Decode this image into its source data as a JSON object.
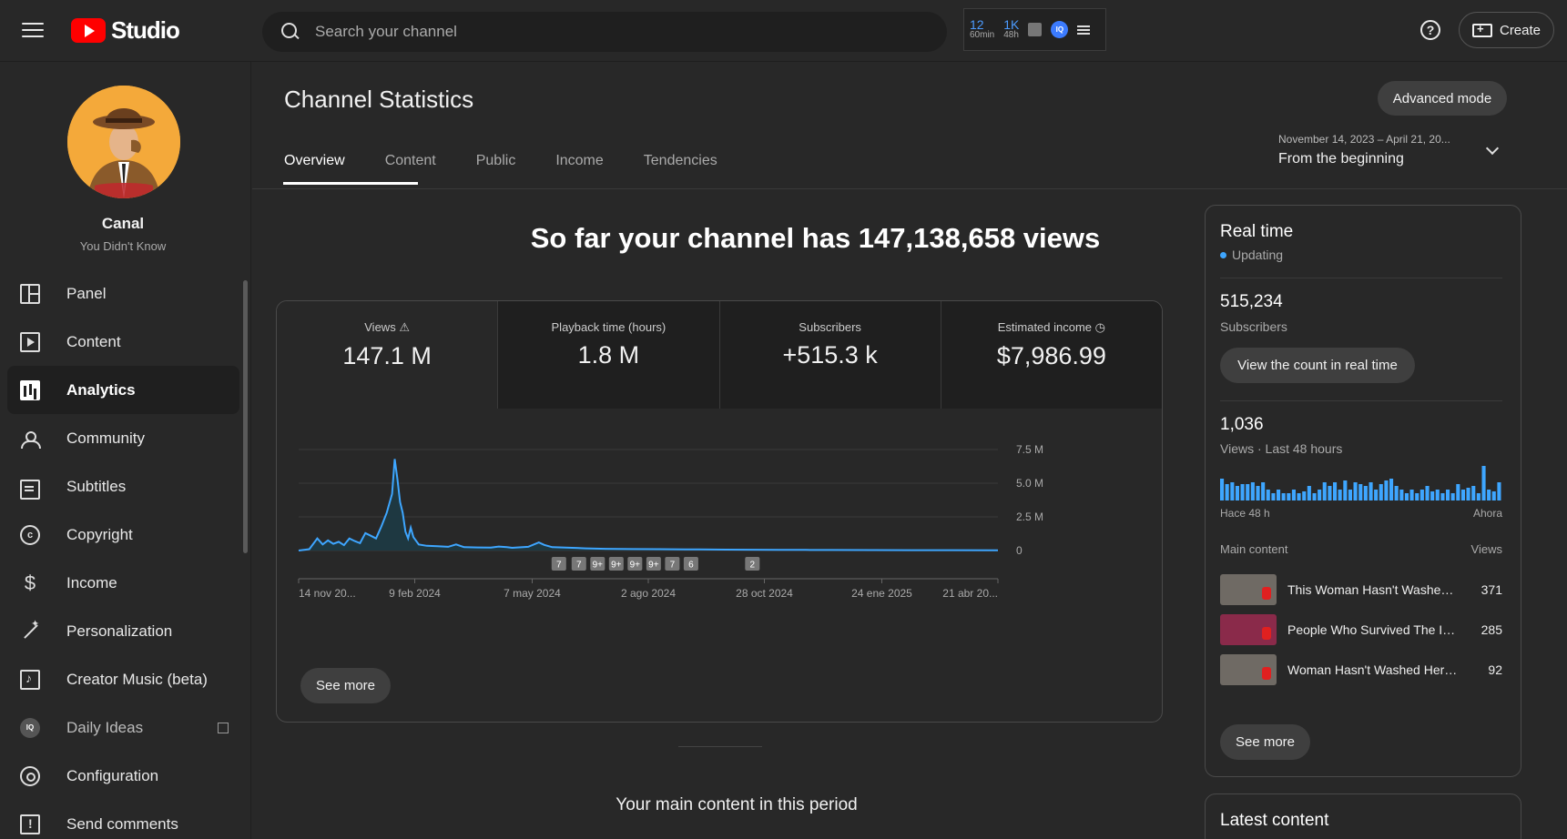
{
  "header": {
    "logo_text": "Studio",
    "search_placeholder": "Search your channel",
    "ext": {
      "stat1_value": "12",
      "stat1_label": "60min",
      "stat2_value": "1K",
      "stat2_label": "48h",
      "iq": "IQ"
    },
    "create_label": "Create",
    "help_glyph": "?"
  },
  "sidebar": {
    "channel_title": "Canal",
    "channel_subtitle": "You Didn't Know",
    "items": [
      {
        "label": "Panel",
        "icon": "dashboard-icon"
      },
      {
        "label": "Content",
        "icon": "content-icon"
      },
      {
        "label": "Analytics",
        "icon": "analytics-icon",
        "active": true
      },
      {
        "label": "Community",
        "icon": "community-icon"
      },
      {
        "label": "Subtitles",
        "icon": "subtitles-icon"
      },
      {
        "label": "Copyright",
        "icon": "copyright-icon"
      },
      {
        "label": "Income",
        "icon": "dollar-icon"
      },
      {
        "label": "Personalization",
        "icon": "magic-wand-icon"
      },
      {
        "label": "Creator Music (beta)",
        "icon": "music-icon"
      },
      {
        "label": "Daily Ideas",
        "icon": "iq-icon",
        "external": true
      },
      {
        "label": "Configuration",
        "icon": "gear-icon"
      },
      {
        "label": "Send comments",
        "icon": "feedback-icon"
      }
    ],
    "copyright_glyph": "c",
    "dollar_glyph": "$",
    "iq_glyph": "IQ"
  },
  "main": {
    "page_title": "Channel Statistics",
    "advanced_mode": "Advanced mode",
    "tabs": [
      "Overview",
      "Content",
      "Public",
      "Income",
      "Tendencies"
    ],
    "date_range": {
      "range": "November 14, 2023 – April 21, 20...",
      "label": "From the beginning"
    },
    "headline": "So far your channel has 147,138,658 views",
    "metrics": [
      {
        "label": "Views",
        "value": "147.1 M"
      },
      {
        "label": "Playback time (hours)",
        "value": "1.8 M"
      },
      {
        "label": "Subscribers",
        "value": "+515.3 k"
      },
      {
        "label": "Estimated income",
        "value": "$7,986.99"
      }
    ],
    "see_more": "See more",
    "main_content_title": "Your main content in this period"
  },
  "chart_data": {
    "type": "line",
    "ytick_labels": [
      "7.5 M",
      "5.0 M",
      "2.5 M",
      "0"
    ],
    "yticks": [
      7500000,
      5000000,
      2500000,
      0
    ],
    "ylim": [
      0,
      7500000
    ],
    "xtick_labels": [
      "14 nov 20...",
      "9 feb 2024",
      "7 may 2024",
      "2 ago 2024",
      "28 oct 2024",
      "24 ene 2025",
      "21 abr 20..."
    ],
    "x_range_days": [
      0,
      524
    ],
    "xtick_days": [
      0,
      87,
      175,
      262,
      349,
      437,
      524
    ],
    "series": [
      {
        "points": [
          [
            0,
            0
          ],
          [
            8,
            100000
          ],
          [
            14,
            900000
          ],
          [
            18,
            450000
          ],
          [
            22,
            750000
          ],
          [
            26,
            500000
          ],
          [
            30,
            650000
          ],
          [
            34,
            400000
          ],
          [
            38,
            900000
          ],
          [
            42,
            700000
          ],
          [
            46,
            550000
          ],
          [
            50,
            1300000
          ],
          [
            54,
            1100000
          ],
          [
            58,
            900000
          ],
          [
            62,
            1800000
          ],
          [
            66,
            2800000
          ],
          [
            70,
            4200000
          ],
          [
            72,
            6800000
          ],
          [
            74,
            5300000
          ],
          [
            76,
            3600000
          ],
          [
            78,
            2800000
          ],
          [
            80,
            1400000
          ],
          [
            82,
            900000
          ],
          [
            84,
            1700000
          ],
          [
            86,
            1000000
          ],
          [
            90,
            450000
          ],
          [
            96,
            350000
          ],
          [
            104,
            320000
          ],
          [
            112,
            280000
          ],
          [
            118,
            450000
          ],
          [
            124,
            250000
          ],
          [
            134,
            230000
          ],
          [
            144,
            220000
          ],
          [
            150,
            300000
          ],
          [
            156,
            250000
          ],
          [
            160,
            200000
          ],
          [
            172,
            280000
          ],
          [
            180,
            600000
          ],
          [
            184,
            420000
          ],
          [
            190,
            250000
          ],
          [
            200,
            220000
          ],
          [
            215,
            160000
          ],
          [
            230,
            130000
          ],
          [
            250,
            110000
          ],
          [
            270,
            100000
          ],
          [
            290,
            90000
          ],
          [
            300,
            80000
          ],
          [
            320,
            70000
          ],
          [
            340,
            60000
          ],
          [
            360,
            50000
          ],
          [
            380,
            45000
          ],
          [
            400,
            40000
          ],
          [
            430,
            35000
          ],
          [
            460,
            30000
          ],
          [
            490,
            25000
          ],
          [
            524,
            20000
          ]
        ]
      }
    ],
    "markers": [
      {
        "day": 195,
        "label": "7"
      },
      {
        "day": 210,
        "label": "7"
      },
      {
        "day": 224,
        "label": "9+"
      },
      {
        "day": 238,
        "label": "9+"
      },
      {
        "day": 252,
        "label": "9+"
      },
      {
        "day": 266,
        "label": "9+"
      },
      {
        "day": 280,
        "label": "7"
      },
      {
        "day": 294,
        "label": "6"
      },
      {
        "day": 340,
        "label": "2"
      }
    ],
    "colors": {
      "line": "#3ea6ff",
      "fill": "#1d3a44",
      "grid": "#3a3a3a"
    }
  },
  "realtime": {
    "title": "Real time",
    "status": "Updating",
    "subscribers_value": "515,234",
    "subscribers_label": "Subscribers",
    "count_button": "View the count in real time",
    "views_value": "1,036",
    "views_label": "Views · Last 48 hours",
    "bars": [
      0.6,
      0.45,
      0.5,
      0.4,
      0.45,
      0.45,
      0.5,
      0.4,
      0.5,
      0.3,
      0.2,
      0.3,
      0.2,
      0.2,
      0.3,
      0.2,
      0.25,
      0.4,
      0.2,
      0.3,
      0.5,
      0.4,
      0.5,
      0.3,
      0.55,
      0.3,
      0.5,
      0.45,
      0.4,
      0.5,
      0.3,
      0.45,
      0.55,
      0.6,
      0.4,
      0.3,
      0.2,
      0.3,
      0.2,
      0.3,
      0.4,
      0.25,
      0.3,
      0.2,
      0.3,
      0.2,
      0.45,
      0.3,
      0.35,
      0.4,
      0.2,
      0.95,
      0.3,
      0.25,
      0.5
    ],
    "bar_color": "#3ea6ff",
    "axis_left": "Hace 48 h",
    "axis_right": "Ahora",
    "list_header_left": "Main content",
    "list_header_right": "Views",
    "items": [
      {
        "title": "This Woman Hasn't Washed Her Hair...",
        "views": "371",
        "thumb_color": "#6f6a64"
      },
      {
        "title": "People Who Survived The Impossible",
        "views": "285",
        "thumb_color": "#8a2a4a"
      },
      {
        "title": "Woman Hasn't Washed Her Hair In...",
        "views": "92",
        "thumb_color": "#6f6a64"
      }
    ],
    "see_more": "See more"
  },
  "latest": {
    "title": "Latest content"
  }
}
